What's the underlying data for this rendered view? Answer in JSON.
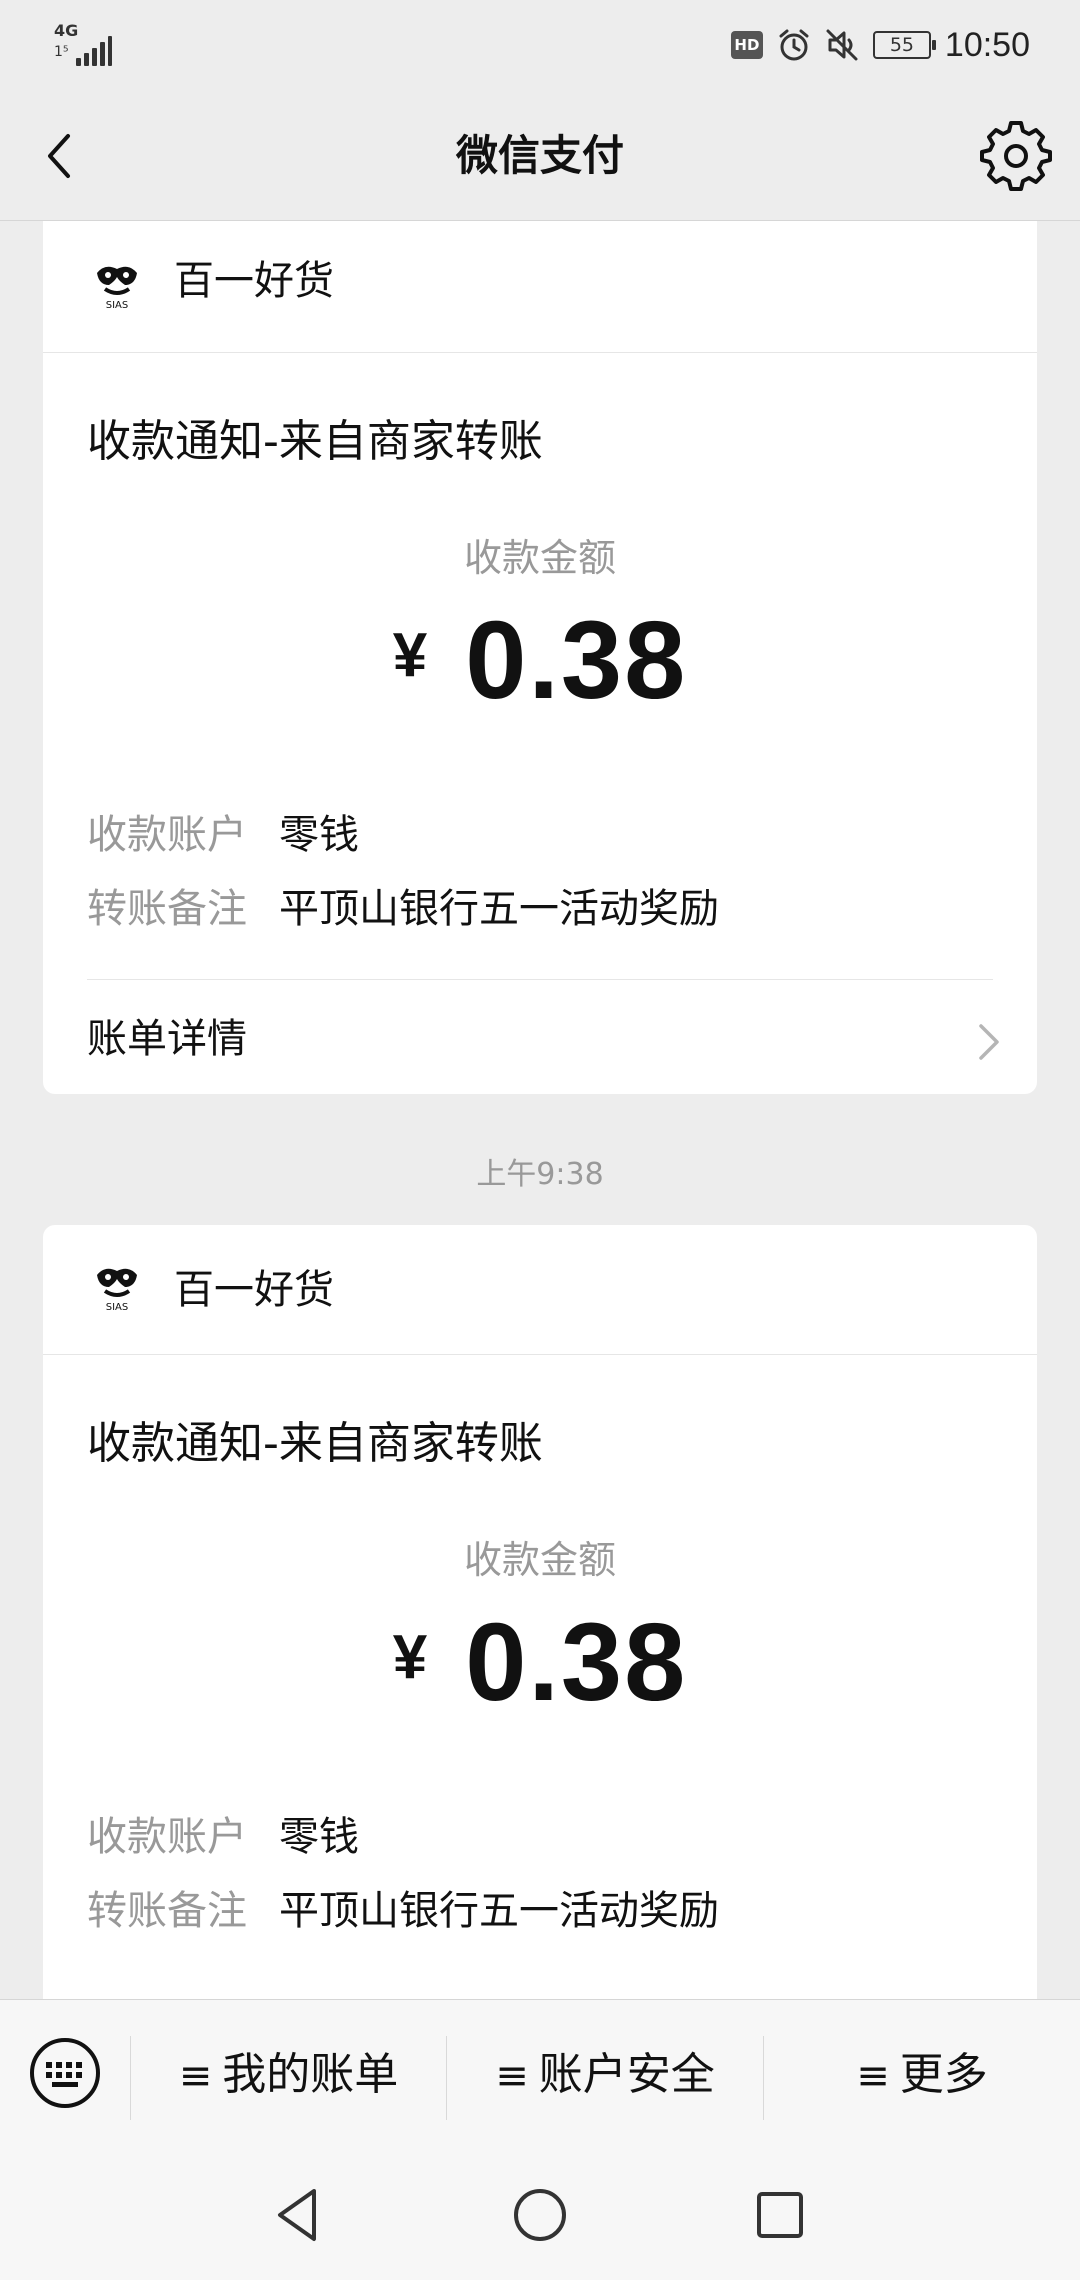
{
  "status_bar": {
    "network": "4G",
    "network_sub": "1⁵",
    "hd": "HD",
    "battery": "55",
    "time": "10:50",
    "icons": [
      "signal-icon",
      "alarm-icon",
      "mute-icon",
      "battery-icon"
    ]
  },
  "header": {
    "title": "微信支付",
    "back_icon": "back-arrow-icon",
    "settings_icon": "gear-icon"
  },
  "messages": [
    {
      "merchant": "百一好货",
      "title": "收款通知-来自商家转账",
      "amount_label": "收款金额",
      "currency": "¥",
      "amount": "0.38",
      "rows": [
        {
          "key": "收款账户",
          "value": "零钱"
        },
        {
          "key": "转账备注",
          "value": "平顶山银行五一活动奖励"
        }
      ],
      "detail_label": "账单详情"
    },
    {
      "timestamp": "上午9:38",
      "merchant": "百一好货",
      "title": "收款通知-来自商家转账",
      "amount_label": "收款金额",
      "currency": "¥",
      "amount": "0.38",
      "rows": [
        {
          "key": "收款账户",
          "value": "零钱"
        },
        {
          "key": "转账备注",
          "value": "平顶山银行五一活动奖励"
        }
      ]
    }
  ],
  "bottom_menu": {
    "keyboard_icon": "keyboard-icon",
    "items": [
      {
        "label": "我的账单",
        "icon": "≡"
      },
      {
        "label": "账户安全",
        "icon": "≡"
      },
      {
        "label": "更多",
        "icon": "≡"
      }
    ]
  },
  "nav_bar": {
    "icons": [
      "nav-back-icon",
      "nav-home-icon",
      "nav-recents-icon"
    ]
  },
  "colors": {
    "background": "#ededed",
    "card": "#ffffff",
    "secondary_text": "#999999",
    "primary_text": "#111111"
  }
}
